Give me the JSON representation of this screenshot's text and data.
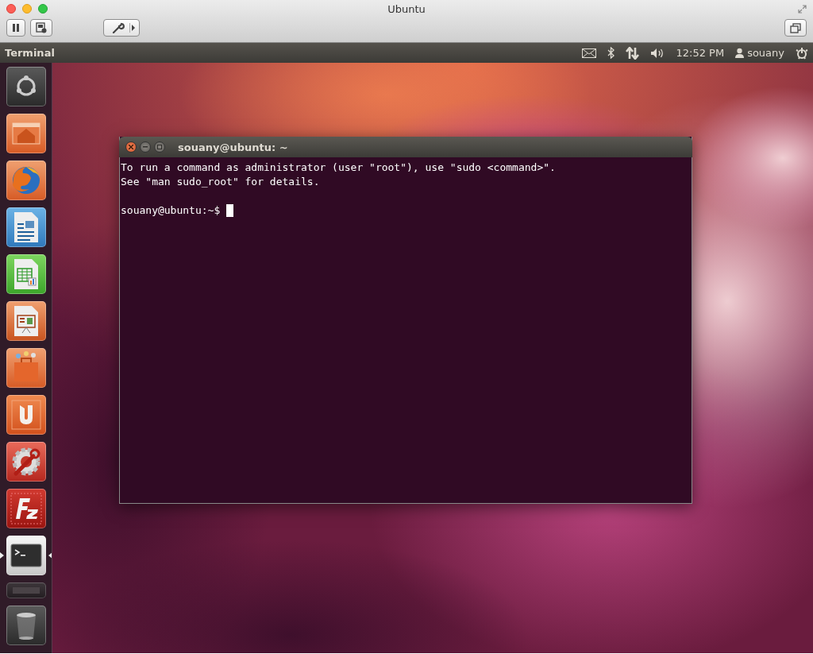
{
  "window": {
    "title": "Ubuntu"
  },
  "panel": {
    "app_name": "Terminal",
    "clock": "12:52 PM",
    "user": "souany"
  },
  "launcher": {
    "items": [
      {
        "kind": "dash",
        "running": false,
        "focused": false
      },
      {
        "kind": "home",
        "running": false,
        "focused": false
      },
      {
        "kind": "firefox",
        "running": false,
        "focused": false
      },
      {
        "kind": "writer",
        "running": false,
        "focused": false
      },
      {
        "kind": "calc",
        "running": false,
        "focused": false
      },
      {
        "kind": "impress",
        "running": false,
        "focused": false
      },
      {
        "kind": "store",
        "running": false,
        "focused": false
      },
      {
        "kind": "ubuntuone",
        "running": false,
        "focused": false
      },
      {
        "kind": "settings",
        "running": false,
        "focused": false
      },
      {
        "kind": "filezilla",
        "running": false,
        "focused": false
      },
      {
        "kind": "terminal",
        "running": true,
        "focused": true
      },
      {
        "kind": "workspaces",
        "running": false,
        "focused": false
      },
      {
        "kind": "trash",
        "running": false,
        "focused": false
      }
    ]
  },
  "terminal": {
    "title": "souany@ubuntu: ~",
    "lines": [
      "To run a command as administrator (user \"root\"), use \"sudo <command>\".",
      "See \"man sudo_root\" for details."
    ],
    "prompt": "souany@ubuntu:~$ "
  }
}
